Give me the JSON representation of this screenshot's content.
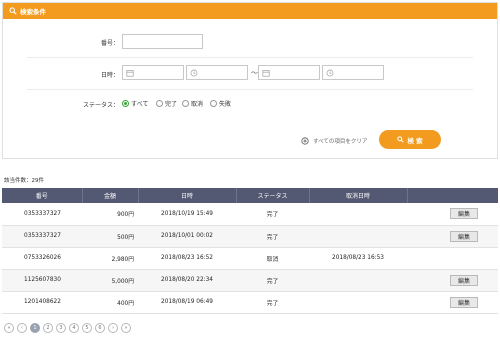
{
  "search_panel": {
    "title": "検索条件",
    "fields": {
      "number_label": "番号：",
      "datetime_label": "日時：",
      "range_separator": "〜",
      "status_label": "ステータス："
    },
    "status_options": [
      {
        "label": "すべて",
        "selected": true
      },
      {
        "label": "完了",
        "selected": false
      },
      {
        "label": "取消",
        "selected": false
      },
      {
        "label": "失敗",
        "selected": false
      }
    ],
    "clear_label": "すべての項目をクリア",
    "search_button_label": "検 索"
  },
  "result_count": "該当件数：29件",
  "table": {
    "headers": [
      "番号",
      "金額",
      "日時",
      "ステータス",
      "取消日時",
      ""
    ],
    "rows": [
      {
        "number": "0353337327",
        "amount": "900円",
        "datetime": "2018/10/19 15:49",
        "status": "完了",
        "cancel_datetime": "",
        "action": "編集"
      },
      {
        "number": "0353337327",
        "amount": "500円",
        "datetime": "2018/10/01 00:02",
        "status": "完了",
        "cancel_datetime": "",
        "action": "編集"
      },
      {
        "number": "0753326026",
        "amount": "2,980円",
        "datetime": "2018/08/23 16:52",
        "status": "取消",
        "cancel_datetime": "2018/08/23 16:53",
        "action": ""
      },
      {
        "number": "1125607830",
        "amount": "5,000円",
        "datetime": "2018/08/20 22:34",
        "status": "完了",
        "cancel_datetime": "",
        "action": "編集"
      },
      {
        "number": "1201408622",
        "amount": "400円",
        "datetime": "2018/08/19 06:49",
        "status": "完了",
        "cancel_datetime": "",
        "action": "編集"
      }
    ]
  },
  "pagination": {
    "first": "«",
    "prev": "‹",
    "pages": [
      "1",
      "2",
      "3",
      "4",
      "5",
      "6"
    ],
    "current": "1",
    "next": "›",
    "last": "»"
  },
  "colors": {
    "accent": "#f29b1e",
    "table_header": "#535973",
    "radio_selected": "#3aa53a"
  }
}
